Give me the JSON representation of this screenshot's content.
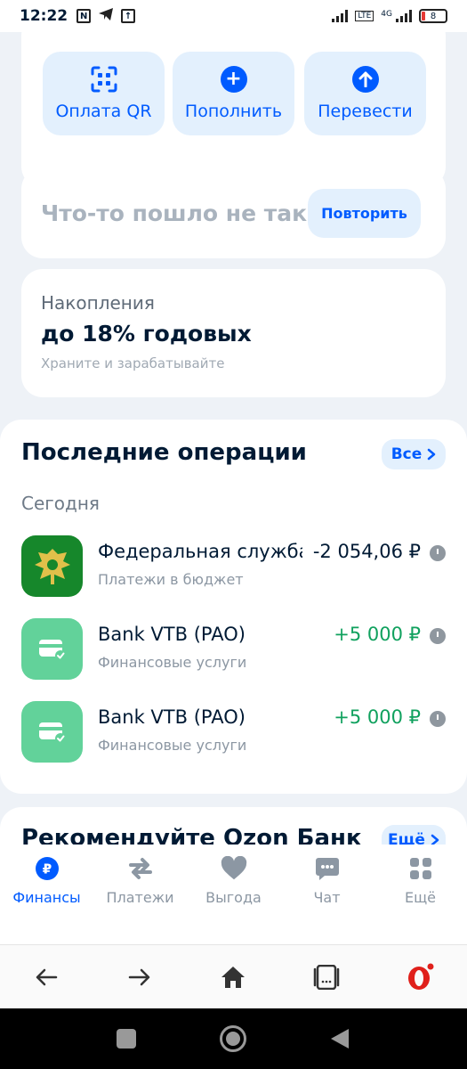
{
  "status_bar": {
    "time": "12:22",
    "battery": "8"
  },
  "quick_actions": [
    {
      "label": "Оплата QR",
      "icon": "qr-icon"
    },
    {
      "label": "Пополнить",
      "icon": "plus-icon"
    },
    {
      "label": "Перевести",
      "icon": "arrow-up-icon"
    }
  ],
  "error_card": {
    "text": "Что-то пошло не так",
    "retry_label": "Повторить"
  },
  "savings": {
    "title": "Накопления",
    "headline": "до 18% годовых",
    "subtitle": "Храните и зарабатывайте"
  },
  "operations": {
    "title": "Последние операции",
    "all_label": "Все",
    "day": "Сегодня",
    "items": [
      {
        "name": "Федеральная служба",
        "category": "Платежи в бюджет",
        "amount": "-2 054,06 ₽",
        "type": "negative",
        "logo": "fns-emblem"
      },
      {
        "name": "Bank VTB (PAO)",
        "category": "Финансовые услуги",
        "amount": "+5 000 ₽",
        "type": "positive",
        "logo": "card-icon"
      },
      {
        "name": "Bank VTB (PAO)",
        "category": "Финансовые услуги",
        "amount": "+5 000 ₽",
        "type": "positive",
        "logo": "card-icon"
      }
    ]
  },
  "recommend": {
    "title": "Рекомендуйте Ozon Банк",
    "more_label": "Ещё"
  },
  "bottom_nav": [
    {
      "label": "Финансы",
      "icon": "ruble-icon",
      "active": true
    },
    {
      "label": "Платежи",
      "icon": "transfer-arrows-icon",
      "active": false
    },
    {
      "label": "Выгода",
      "icon": "heart-icon",
      "active": false
    },
    {
      "label": "Чат",
      "icon": "chat-icon",
      "active": false
    },
    {
      "label": "Ещё",
      "icon": "grid-icon",
      "active": false
    }
  ],
  "colors": {
    "accent": "#005bff",
    "positive": "#10a15e",
    "fed_green": "#16872b",
    "card_green": "#62d29a"
  }
}
